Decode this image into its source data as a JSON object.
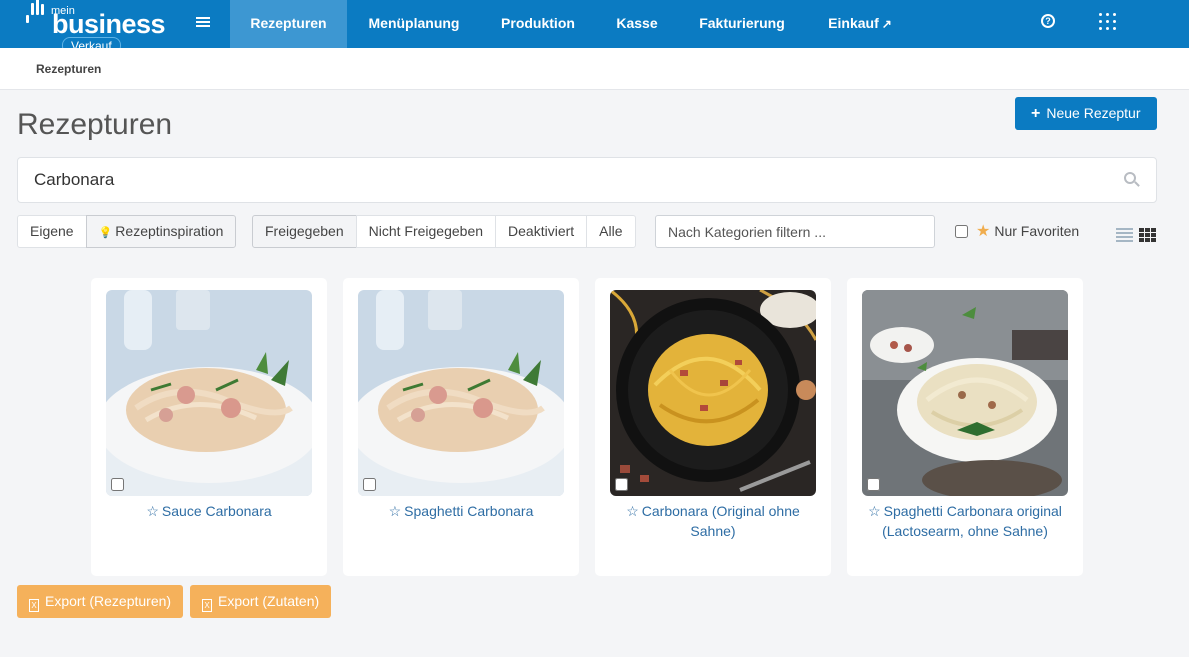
{
  "logo": {
    "mein": "mein",
    "business": "business",
    "badge": "Verkauf"
  },
  "nav": {
    "items": [
      {
        "label": "Rezepturen",
        "active": true
      },
      {
        "label": "Menüplanung"
      },
      {
        "label": "Produktion"
      },
      {
        "label": "Kasse"
      },
      {
        "label": "Fakturierung"
      },
      {
        "label": "Einkauf"
      }
    ],
    "icons": {
      "hamburger": "hamburger-icon",
      "external": "external-link-icon",
      "help": "help-circle-icon",
      "apps": "apps-grid-icon"
    }
  },
  "breadcrumb": {
    "current": "Rezepturen"
  },
  "page": {
    "title": "Rezepturen",
    "new_button": "Neue Rezeptur"
  },
  "search": {
    "value": "Carbonara",
    "icon": "search-icon"
  },
  "filters": {
    "scope": [
      "Eigene",
      "Rezeptinspiration"
    ],
    "scope_active": "Rezeptinspiration",
    "status": [
      "Freigegeben",
      "Nicht Freigegeben",
      "Deaktiviert",
      "Alle"
    ],
    "status_active": "Freigegeben",
    "category_placeholder": "Nach Kategorien filtern ...",
    "favorites_label": "Nur Favoriten"
  },
  "view_modes": [
    "list-view-icon",
    "tile-view-icon"
  ],
  "recipes": [
    {
      "title": "Sauce Carbonara",
      "image": "pasta-cream-plate"
    },
    {
      "title": "Spaghetti Carbonara",
      "image": "pasta-cream-plate"
    },
    {
      "title": "Carbonara (Original ohne Sahne)",
      "image": "spaghetti-black-plate"
    },
    {
      "title": "Spaghetti Carbonara original (Lactosearm, ohne Sahne)",
      "image": "spaghetti-white-bowl"
    }
  ],
  "exports": [
    "Export (Rezepturen)",
    "Export (Zutaten)"
  ],
  "colors": {
    "primary": "#0b7bc2",
    "nav_active": "#3d97d2",
    "export": "#f5b15b",
    "link": "#2e6da4",
    "favorite": "#f0ad4e"
  }
}
